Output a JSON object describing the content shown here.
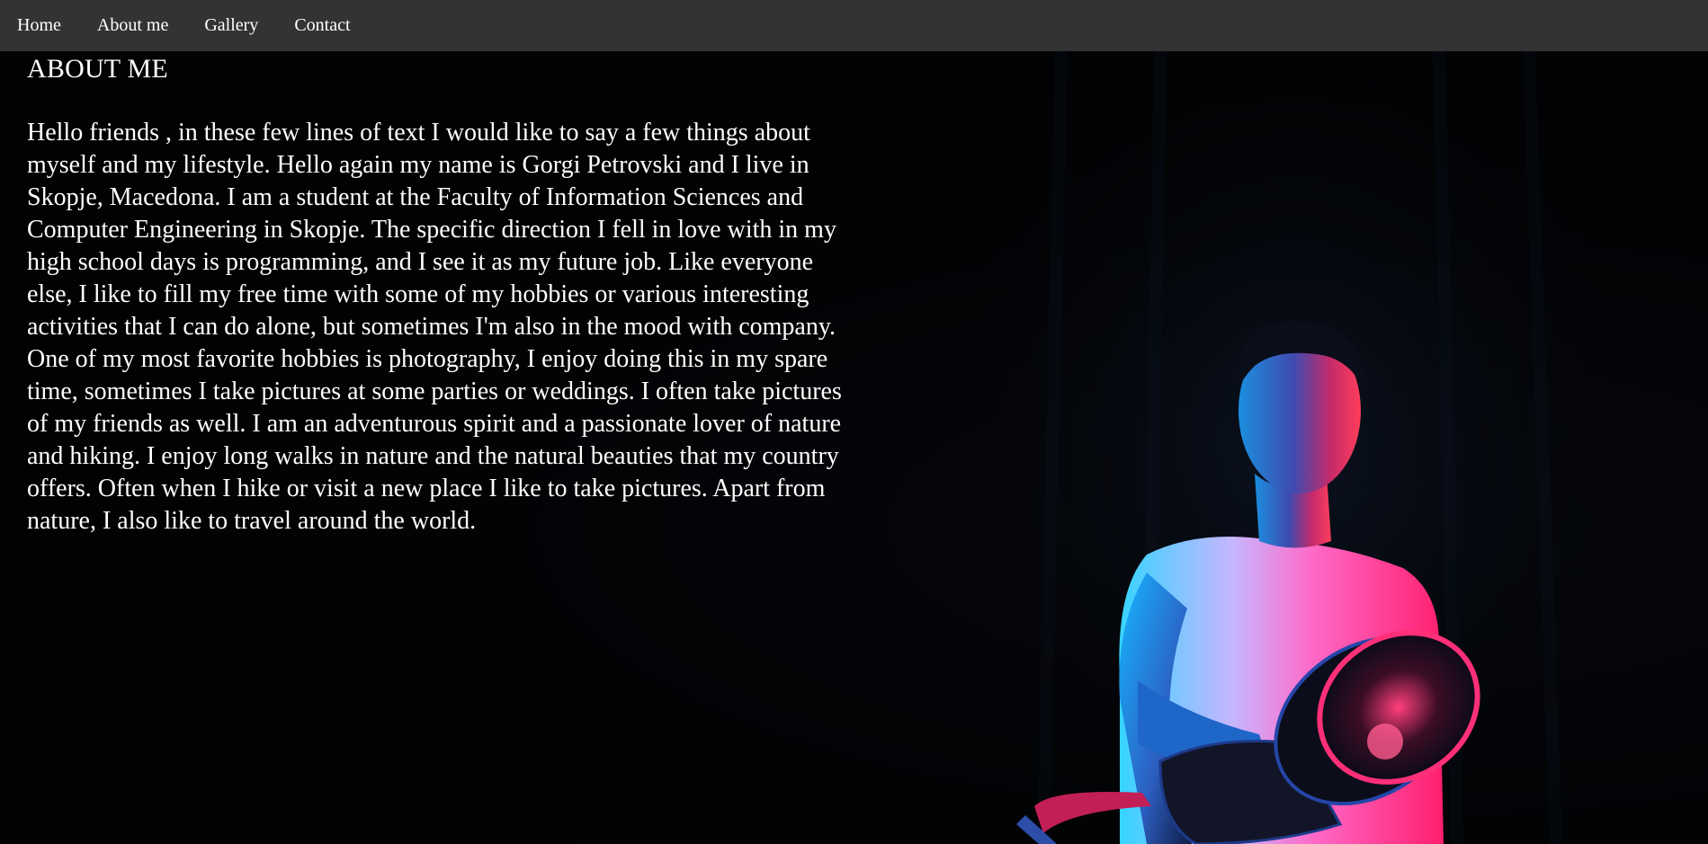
{
  "nav": {
    "items": [
      {
        "label": "Home"
      },
      {
        "label": "About me"
      },
      {
        "label": "Gallery"
      },
      {
        "label": "Contact"
      }
    ]
  },
  "about": {
    "title": "ABOUT ME",
    "paragraph": "Hello friends , in these few lines of text I would like to say a few things about myself and my lifestyle. Hello again my name is Gorgi Petrovski and I live in Skopje, Macedona. I am a student at the Faculty of Information Sciences and Computer Engineering in Skopje. The specific direction I fell in love with in my high school days is programming, and I see it as my future job. Like everyone else, I like to fill my free time with some of my hobbies or various interesting activities that I can do alone, but sometimes I'm also in the mood with company. One of my most favorite hobbies is photography, I enjoy doing this in my spare time, sometimes I take pictures at some parties or weddings. I often take pictures of my friends as well. I am an adventurous spirit and a passionate lover of nature and hiking. I enjoy long walks in nature and the natural beauties that my country offers. Often when I hike or visit a new place I like to take pictures. Apart from nature, I also like to travel around the world."
  },
  "colors": {
    "nav_bg": "#333333",
    "page_bg": "#010203",
    "text": "#ffffff",
    "light_pink": "#ff2a8a",
    "light_blue": "#12b8ff"
  },
  "image": {
    "subject": "man-holding-camera-photo"
  }
}
